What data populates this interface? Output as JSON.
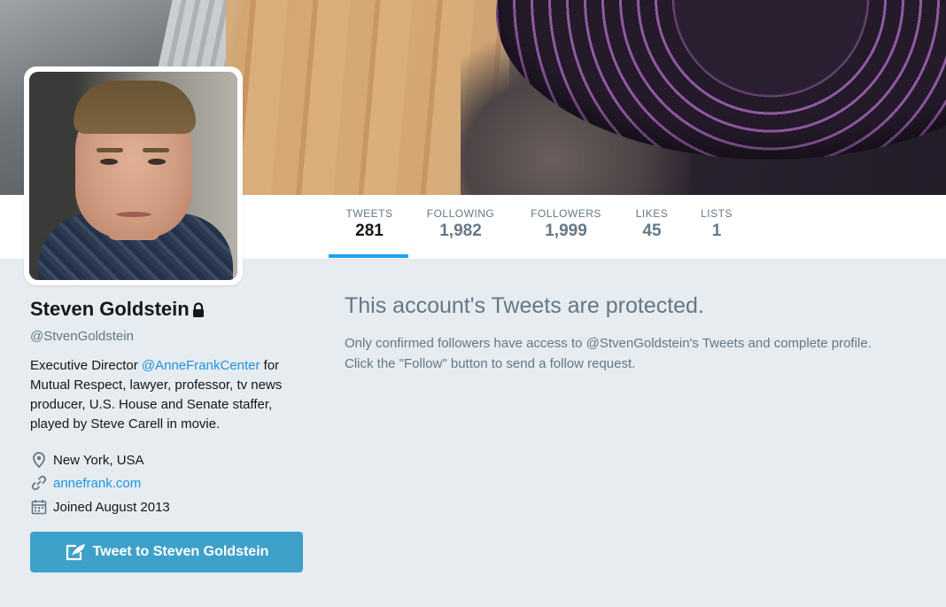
{
  "nav": {
    "stats": [
      {
        "label": "TWEETS",
        "value": "281"
      },
      {
        "label": "FOLLOWING",
        "value": "1,982"
      },
      {
        "label": "FOLLOWERS",
        "value": "1,999"
      },
      {
        "label": "LIKES",
        "value": "45"
      },
      {
        "label": "LISTS",
        "value": "1"
      }
    ],
    "active_tab": "TWEETS"
  },
  "profile": {
    "name": "Steven Goldstein",
    "handle": "@StvenGoldstein",
    "bio_prefix": "Executive Director ",
    "bio_mention": "@AnneFrankCenter",
    "bio_rest": " for Mutual Respect, lawyer, professor, tv news producer, U.S. House and Senate staffer, played by Steve Carell in movie.",
    "location": "New York, USA",
    "website": "annefrank.com",
    "joined": "Joined August 2013",
    "tweet_button_label": "Tweet to Steven Goldstein"
  },
  "protected": {
    "title": "This account's Tweets are protected.",
    "line1": "Only confirmed followers have access to @StvenGoldstein's Tweets and complete profile.",
    "line2": "Click the \"Follow\" button to send a follow request."
  },
  "colors": {
    "accent": "#1da1f2",
    "link": "#1b95e0",
    "button": "#3ea1c9",
    "muted": "#657786",
    "background": "#e6ecf0"
  },
  "icons": [
    "lock-icon",
    "location-icon",
    "link-icon",
    "calendar-icon",
    "compose-icon"
  ]
}
